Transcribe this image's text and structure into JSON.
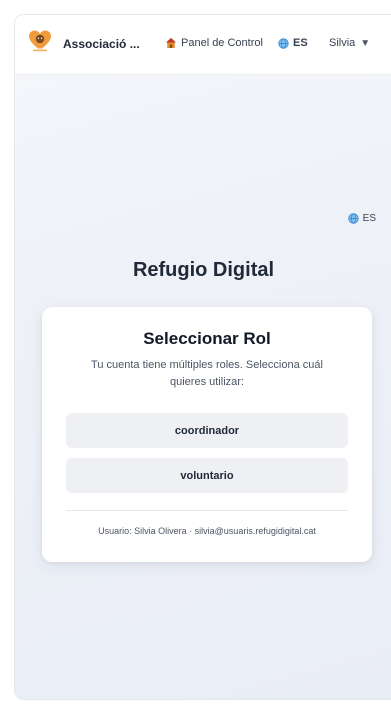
{
  "header": {
    "brand": "Associació ...",
    "panel_label": "Panel de Control",
    "lang_label": "ES",
    "user_label": "Silvia"
  },
  "lang_switch": {
    "label": "ES"
  },
  "main": {
    "title": "Refugio Digital"
  },
  "role_card": {
    "title": "Seleccionar Rol",
    "description": "Tu cuenta tiene múltiples roles. Selecciona cuál quieres utilizar:",
    "roles": [
      "coordinador",
      "voluntario"
    ],
    "user_info": "Usuario: Silvia Olivera · silvia@usuaris.refugidigital.cat"
  }
}
